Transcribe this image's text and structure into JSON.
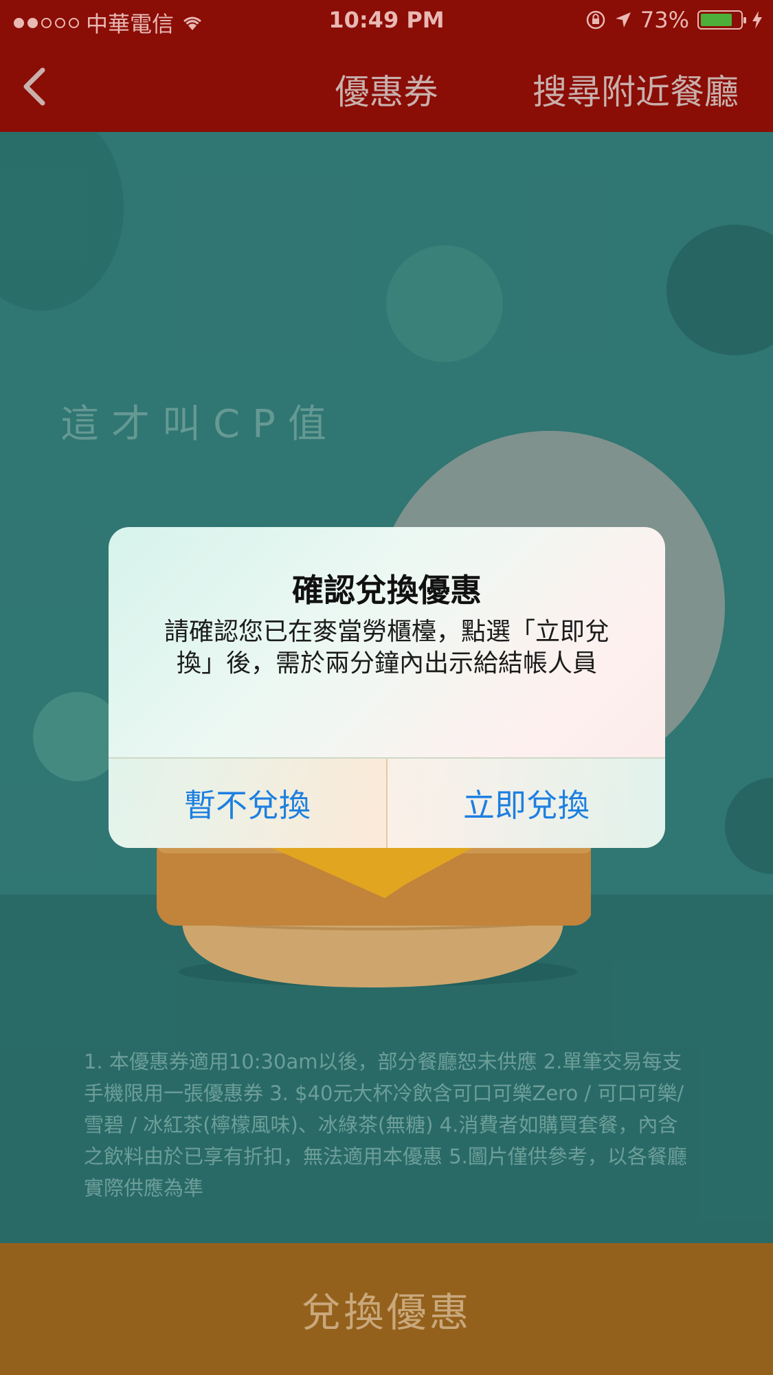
{
  "status_bar": {
    "carrier": "中華電信",
    "time": "10:49 PM",
    "battery": "73%",
    "icons": [
      "wifi-icon",
      "rotation-lock-icon",
      "location-arrow-icon",
      "battery-icon",
      "charging-bolt-icon"
    ]
  },
  "nav": {
    "back_icon": "chevron-left-icon",
    "title": "優惠券",
    "nearby": "搜尋附近餐廳"
  },
  "coupon": {
    "slogan": "這才叫CP值",
    "terms": "1. 本優惠券適用10:30am以後，部分餐廳恕未供應 2.單筆交易每支手機限用一張優惠券 3. $40元大杯冷飲含可口可樂Zero / 可口可樂/雪碧 / 冰紅茶(檸檬風味)、冰綠茶(無糖) 4.消費者如購買套餐，內含之飲料由於已享有折扣，無法適用本優惠 5.圖片僅供參考，以各餐廳實際供應為準"
  },
  "alert": {
    "title": "確認兌換優惠",
    "message": "請確認您已在麥當勞櫃檯，點選「立即兌換」後，需於兩分鐘內出示給結帳人員",
    "cancel_label": "暫不兌換",
    "confirm_label": "立即兌換"
  },
  "redeem_bar": {
    "label": "兌換優惠"
  },
  "colors": {
    "header_red": "#8a0d06",
    "coupon_teal": "#35807c",
    "redeem_gold": "#94611c",
    "ios_blue": "#1d7fe0"
  }
}
